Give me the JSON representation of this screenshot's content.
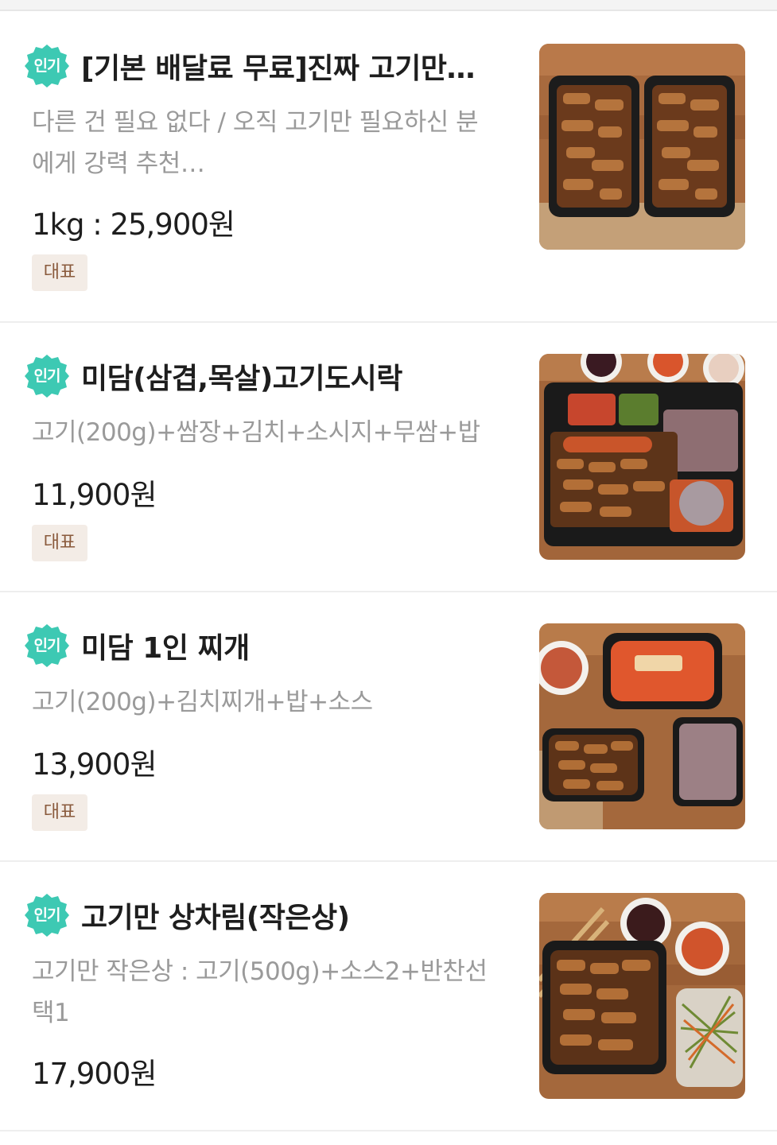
{
  "items": [
    {
      "badge": "인기",
      "title": "[기본 배달료 무료]진짜 고기만…",
      "desc_line1": "다른 건 필요 없다 / 오직 고기만 필요하신 분",
      "desc_line2": "에게 강력 추천…",
      "price": "1kg : 25,900원",
      "tag": "대표",
      "image": "two-trays-grilled-pork"
    },
    {
      "badge": "인기",
      "title": "미담(삼겹,목살)고기도시락",
      "desc_line1": "고기(200g)+쌈장+김치+소시지+무쌈+밥",
      "price": "11,900원",
      "tag": "대표",
      "image": "lunchbox-pork-sausage-rice"
    },
    {
      "badge": "인기",
      "title": "미담 1인 찌개",
      "desc_line1": "고기(200g)+김치찌개+밥+소스",
      "price": "13,900원",
      "tag": "대표",
      "image": "pork-stew-rice-set"
    },
    {
      "badge": "인기",
      "title": "고기만 상차림(작은상)",
      "desc_line1": "고기만 작은상 : 고기(500g)+소스2+반찬선",
      "desc_line2": "택1",
      "price": "17,900원",
      "image": "pork-sauces-side-salad"
    }
  ],
  "colors": {
    "badge": "#3dc9b3",
    "tag_bg": "#f3ece6",
    "tag_text": "#8a5a3c"
  }
}
